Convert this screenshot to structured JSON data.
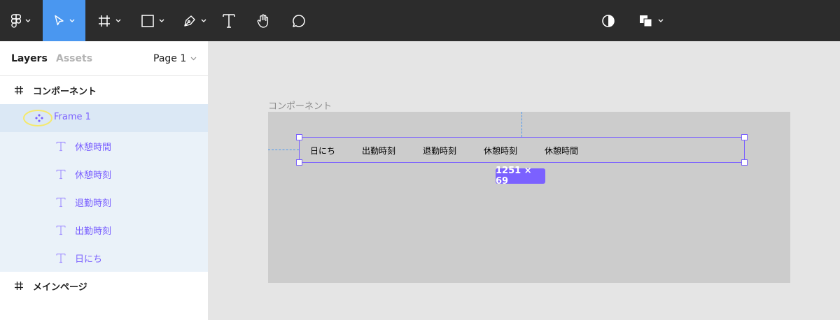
{
  "toolbar": {
    "tools": [
      {
        "name": "figma-main-menu",
        "has_caret": true
      },
      {
        "name": "move-tool",
        "has_caret": true,
        "active": true
      },
      {
        "name": "frame-tool",
        "has_caret": true
      },
      {
        "name": "rectangle-tool",
        "has_caret": true
      },
      {
        "name": "pen-tool",
        "has_caret": true
      },
      {
        "name": "text-tool",
        "has_caret": false
      },
      {
        "name": "hand-tool",
        "has_caret": false
      },
      {
        "name": "comment-tool",
        "has_caret": false
      }
    ],
    "right_tools": [
      {
        "name": "mask-contrast-tool",
        "has_caret": false
      },
      {
        "name": "component-tool",
        "has_caret": true
      }
    ],
    "colors": {
      "bg": "#2c2c2c",
      "active": "#4a97f0"
    }
  },
  "panel": {
    "tabs": {
      "layers": "Layers",
      "assets": "Assets"
    },
    "page_selector": "Page 1",
    "layers": [
      {
        "label": "コンポーネント",
        "icon": "frame-hash-icon",
        "level": 0,
        "state": "normal"
      },
      {
        "label": "Frame 1",
        "icon": "component-icon",
        "level": 1,
        "state": "selected"
      },
      {
        "label": "休憩時間",
        "icon": "text-layer-icon",
        "level": 2,
        "state": "child-selected"
      },
      {
        "label": "休憩時刻",
        "icon": "text-layer-icon",
        "level": 2,
        "state": "child-selected"
      },
      {
        "label": "退勤時刻",
        "icon": "text-layer-icon",
        "level": 2,
        "state": "child-selected"
      },
      {
        "label": "出勤時刻",
        "icon": "text-layer-icon",
        "level": 2,
        "state": "child-selected"
      },
      {
        "label": "日にち",
        "icon": "text-layer-icon",
        "level": 2,
        "state": "child-selected"
      },
      {
        "label": "メインページ",
        "icon": "frame-hash-icon",
        "level": 0,
        "state": "normal"
      }
    ]
  },
  "canvas": {
    "artboard_label": "コンポーネント",
    "frame_texts": [
      "日にち",
      "出勤時刻",
      "退勤時刻",
      "休憩時刻",
      "休憩時間"
    ],
    "dimension_badge": "1251 × 69",
    "colors": {
      "selection": "#7b61ff",
      "artboard": "#cccccc",
      "canvas": "#e5e5e5",
      "guide": "#4a97f0"
    }
  }
}
